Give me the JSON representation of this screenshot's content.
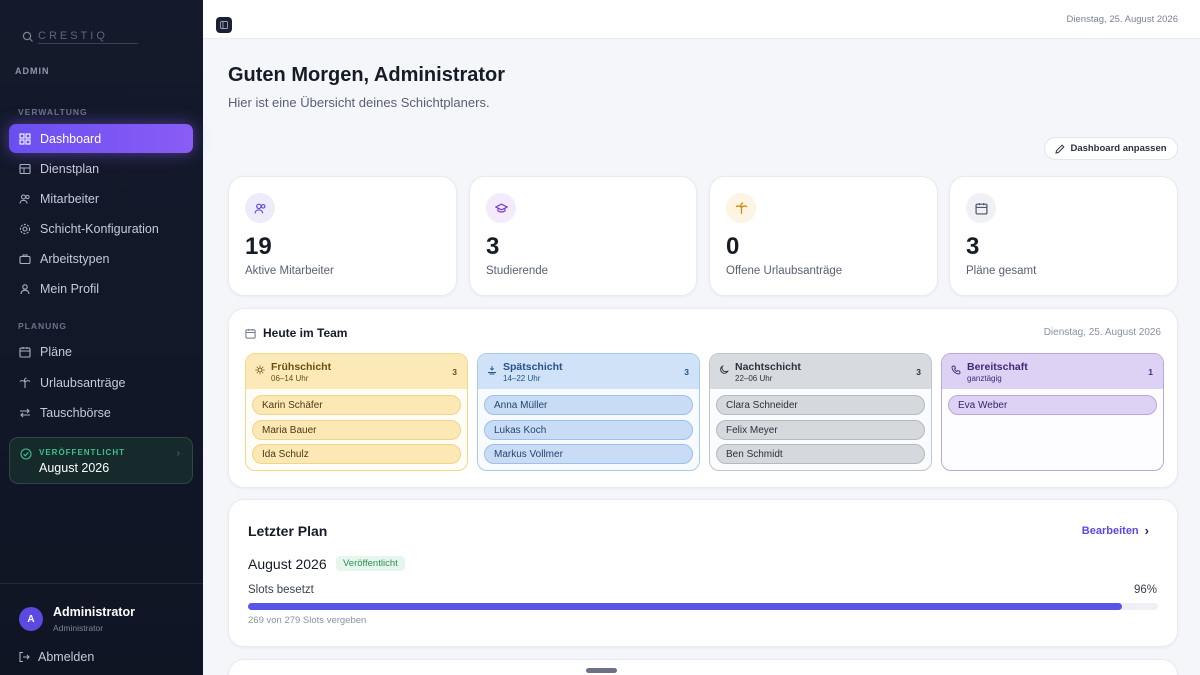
{
  "sidebar": {
    "logo": "CRESTIQ",
    "role": "ADMIN",
    "sections": {
      "verwaltung": "VERWALTUNG",
      "planung": "PLANUNG"
    },
    "nav": [
      {
        "label": "Dashboard",
        "icon": "grid-icon",
        "active": true
      },
      {
        "label": "Dienstplan",
        "icon": "table-icon"
      },
      {
        "label": "Mitarbeiter",
        "icon": "users-icon"
      },
      {
        "label": "Schicht-Konfiguration",
        "icon": "gear-icon"
      },
      {
        "label": "Arbeitstypen",
        "icon": "briefcase-icon"
      },
      {
        "label": "Mein Profil",
        "icon": "user-icon"
      }
    ],
    "nav2": [
      {
        "label": "Pläne",
        "icon": "calendar-icon"
      },
      {
        "label": "Urlaubsanträge",
        "icon": "palm-icon"
      },
      {
        "label": "Tauschbörse",
        "icon": "swap-icon"
      }
    ],
    "published": {
      "label": "VERÖFFENTLICHT",
      "value": "August 2026"
    },
    "user": {
      "initial": "A",
      "name": "Administrator",
      "role": "Administrator"
    },
    "logout": "Abmelden"
  },
  "topbar": {
    "date": "Dienstag, 25. August 2026"
  },
  "main": {
    "greeting": "Guten Morgen, Administrator",
    "subtitle": "Hier ist eine Übersicht deines Schichtplaners.",
    "customize": "Dashboard anpassen",
    "stats": [
      {
        "value": "19",
        "label": "Aktive Mitarbeiter",
        "icon": "users-icon",
        "color": "#5b49e0"
      },
      {
        "value": "3",
        "label": "Studierende",
        "icon": "graduation-cap-icon",
        "color": "#7a3fc9"
      },
      {
        "value": "0",
        "label": "Offene Urlaubsanträge",
        "icon": "palm-icon",
        "color": "#d08a12"
      },
      {
        "value": "3",
        "label": "Pläne gesamt",
        "icon": "calendar-icon",
        "color": "#4a5268"
      }
    ],
    "team": {
      "title": "Heute im Team",
      "date": "Dienstag, 25. August 2026",
      "shifts": [
        {
          "name": "Frühschicht",
          "time": "06–14 Uhr",
          "count": "3",
          "people": [
            "Karin Schäfer",
            "Maria Bauer",
            "Ida Schulz"
          ]
        },
        {
          "name": "Spätschicht",
          "time": "14–22 Uhr",
          "count": "3",
          "people": [
            "Anna Müller",
            "Lukas Koch",
            "Markus Vollmer"
          ]
        },
        {
          "name": "Nachtschicht",
          "time": "22–06 Uhr",
          "count": "3",
          "people": [
            "Clara Schneider",
            "Felix Meyer",
            "Ben Schmidt"
          ]
        },
        {
          "name": "Bereitschaft",
          "time": "ganztägig",
          "count": "1",
          "people": [
            "Eva Weber"
          ]
        }
      ]
    },
    "last_plan": {
      "title": "Letzter Plan",
      "edit": "Bearbeiten",
      "month": "August 2026",
      "badge": "Veröffentlicht",
      "slots_label": "Slots besetzt",
      "percent": "96%",
      "fill_fraction": 0.96,
      "info": "269 von 279 Slots vergeben"
    }
  }
}
